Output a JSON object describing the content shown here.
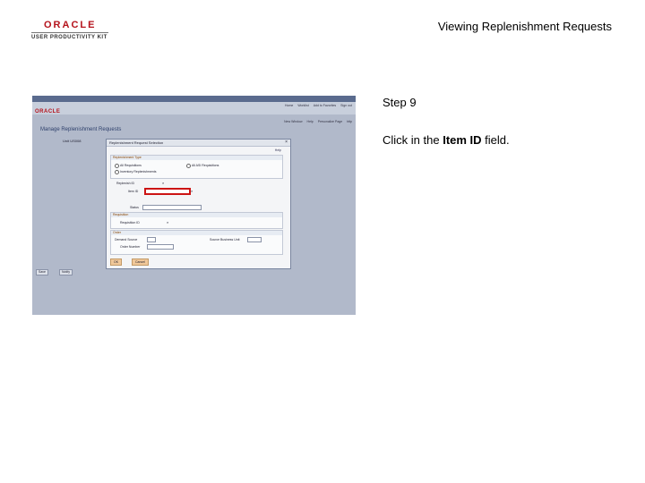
{
  "header": {
    "logo_brand": "ORACLE",
    "logo_product": "USER PRODUCTIVITY KIT",
    "slide_title": "Viewing Replenishment Requests"
  },
  "screenshot": {
    "topbar_items": [
      "Favorites",
      "Main Menu",
      "Inventory",
      "Replenish Inventory",
      "Manage Replenishment Requests"
    ],
    "app_logo": "ORACLE",
    "header_links": [
      "Home",
      "Worklist",
      "Add to Favorites",
      "Sign out"
    ],
    "subnav_links": [
      "New Window",
      "Help",
      "Personalize Page",
      "http"
    ],
    "page_heading": "Manage Replenishment Requests",
    "unit_label": "Unit",
    "unit_value": "US008",
    "modal": {
      "title": "Replenishment Request Selection",
      "close_glyph": "×",
      "help_link": "Help",
      "replenishment_type": {
        "header": "Replenishment Type",
        "opt_all_requisitions": "All Requisitions",
        "opt_all_asi_requisitions": "All ASI Requisitions",
        "opt_inventory_replenishment": "Inventory Replenishments"
      },
      "replenishment_id_label": "Replenish ID",
      "item_id_label": "Item ID",
      "status_label": "Status",
      "requisition": {
        "header": "Requisition",
        "requisition_id_label": "Requisition ID"
      },
      "order": {
        "header": "Order",
        "demand_source_label": "Demand Source",
        "source_business_unit_label": "Source Business Unit",
        "order_number_label": "Order Number"
      },
      "ok_label": "OK",
      "cancel_label": "Cancel"
    },
    "bottom_buttons": {
      "save": "Save",
      "notify": "Notify"
    }
  },
  "instructions": {
    "step_title": "Step 9",
    "text_before": "Click in the ",
    "text_bold": "Item ID",
    "text_after": " field."
  },
  "colors": {
    "highlight": "#cc1414",
    "oracle_red": "#b5121b"
  }
}
